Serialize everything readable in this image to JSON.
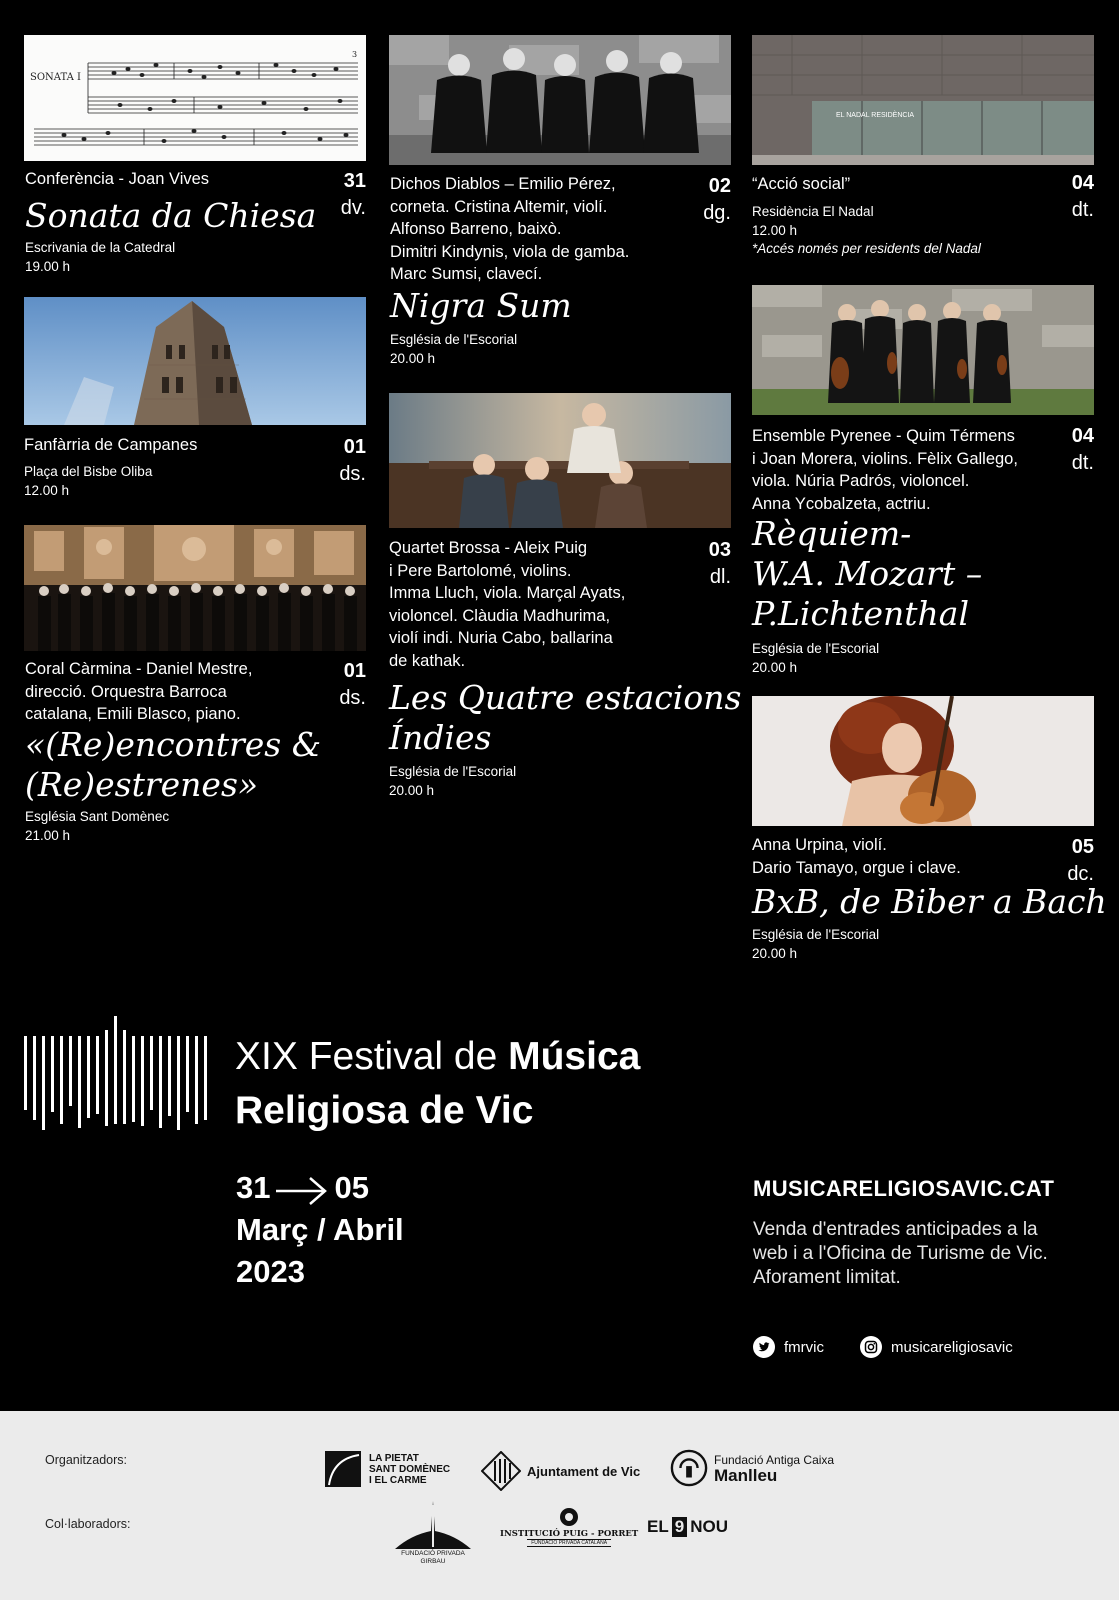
{
  "events": {
    "e1": {
      "head": "Conferència - Joan Vives",
      "day": "31",
      "weekday": "dv.",
      "title": "Sonata da Chiesa",
      "place": "Escrivania de la Catedral",
      "time": "19.00 h",
      "score_label": "SONATA I",
      "score_number": "3"
    },
    "e2": {
      "head": "Fanfàrria de Campanes",
      "day": "01",
      "weekday": "ds.",
      "place": "Plaça del Bisbe Oliba",
      "time": "12.00 h"
    },
    "e3": {
      "head_lines": [
        "Coral Càrmina - Daniel Mestre,",
        "direcció. Orquestra Barroca",
        "catalana, Emili Blasco, piano."
      ],
      "day": "01",
      "weekday": "ds.",
      "title_lines": [
        "«(Re)encontres &",
        "(Re)estrenes»"
      ],
      "place": "Església Sant Domènec",
      "time": "21.00 h"
    },
    "e4": {
      "head_lines": [
        "Dichos Diablos – Emilio Pérez,",
        "corneta. Cristina Altemir, violí.",
        "Alfonso Barreno, baixò.",
        "Dimitri Kindynis, viola de gamba.",
        "Marc Sumsi, clavecí."
      ],
      "day": "02",
      "weekday": "dg.",
      "title": "Nigra Sum",
      "place": "Església de l'Escorial",
      "time": "20.00 h"
    },
    "e5": {
      "head_lines": [
        "Quartet Brossa - Aleix Puig",
        "i Pere Bartolomé, violins.",
        "Imma Lluch, viola. Marçal Ayats,",
        "violoncel. Clàudia Madhurima,",
        "violí indi. Nuria Cabo, ballarina",
        "de kathak."
      ],
      "day": "03",
      "weekday": "dl.",
      "title_lines": [
        "Les Quatre estacions",
        "Índies"
      ],
      "place": "Església de l'Escorial",
      "time": "20.00 h"
    },
    "e6": {
      "head": "“Acció social”",
      "day": "04",
      "weekday": "dt.",
      "place": "Residència El Nadal",
      "time": "12.00 h",
      "note": "*Accés només per residents del Nadal",
      "sign": "EL NADAL RESIDÈNCIA"
    },
    "e7": {
      "head_lines": [
        "Ensemble Pyrenee - Quim Térmens",
        "i Joan Morera, violins. Fèlix Gallego,",
        "viola. Núria Padrós, violoncel.",
        "Anna Ycobalzeta, actriu."
      ],
      "day": "04",
      "weekday": "dt.",
      "title_lines": [
        "Rèquiem-",
        "W.A. Mozart –",
        "P.Lichtenthal"
      ],
      "place": "Església de l'Escorial",
      "time": "20.00 h"
    },
    "e8": {
      "head_lines": [
        "Anna Urpina, violí.",
        "Dario Tamayo, orgue i clave."
      ],
      "day": "05",
      "weekday": "dc.",
      "title": "BxB, de Biber a Bach",
      "place": "Església de l'Escorial",
      "time": "20.00 h"
    }
  },
  "festival": {
    "line1_a": "XIX Festival de ",
    "line1_b": "Música",
    "line2": "Religiosa de Vic",
    "date_from": "31",
    "date_to": "05",
    "months": "Març / Abril",
    "year": "2023",
    "website": "MUSICARELIGIOSAVIC.CAT",
    "info_lines": [
      "Venda d'entrades anticipades a la",
      "web i a l'Oficina de Turisme de Vic.",
      "Aforament limitat."
    ],
    "twitter": "fmrvic",
    "instagram": "musicareligiosavic",
    "icons": [
      "twitter-icon",
      "instagram-icon"
    ]
  },
  "footer": {
    "organizers_label": "Organitzadors:",
    "collaborators_label": "Col·laboradors:",
    "pietat_lines": [
      "LA PIETAT",
      "SANT DOMÈNEC",
      "I EL CARME"
    ],
    "ajuntament": "Ajuntament de Vic",
    "fundacio_line1": "Fundació Antiga Caixa",
    "fundacio_line2": "Manlleu",
    "girbau_lines": [
      "FUNDACIÓ PRIVADA",
      "GIRBAU"
    ],
    "puig_line1": "INSTITUCIÓ PUIG - PORRET",
    "puig_line2": "FUNDACIÓ PRIVADA CATALANA",
    "el9nou_a": "EL",
    "el9nou_num": "9",
    "el9nou_b": "NOU"
  }
}
